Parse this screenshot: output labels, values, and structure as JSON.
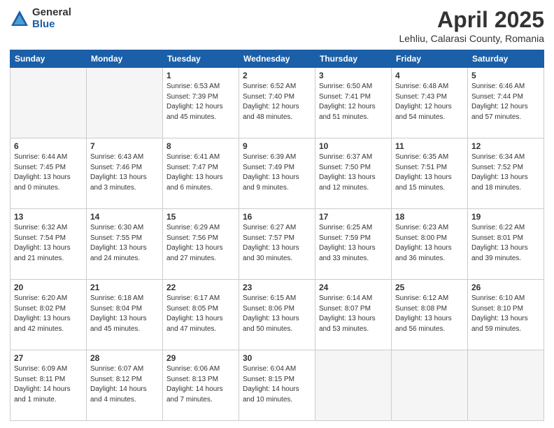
{
  "header": {
    "logo_general": "General",
    "logo_blue": "Blue",
    "main_title": "April 2025",
    "subtitle": "Lehliu, Calarasi County, Romania"
  },
  "calendar": {
    "days_of_week": [
      "Sunday",
      "Monday",
      "Tuesday",
      "Wednesday",
      "Thursday",
      "Friday",
      "Saturday"
    ],
    "weeks": [
      [
        {
          "day": "",
          "info": ""
        },
        {
          "day": "",
          "info": ""
        },
        {
          "day": "1",
          "info": "Sunrise: 6:53 AM\nSunset: 7:39 PM\nDaylight: 12 hours\nand 45 minutes."
        },
        {
          "day": "2",
          "info": "Sunrise: 6:52 AM\nSunset: 7:40 PM\nDaylight: 12 hours\nand 48 minutes."
        },
        {
          "day": "3",
          "info": "Sunrise: 6:50 AM\nSunset: 7:41 PM\nDaylight: 12 hours\nand 51 minutes."
        },
        {
          "day": "4",
          "info": "Sunrise: 6:48 AM\nSunset: 7:43 PM\nDaylight: 12 hours\nand 54 minutes."
        },
        {
          "day": "5",
          "info": "Sunrise: 6:46 AM\nSunset: 7:44 PM\nDaylight: 12 hours\nand 57 minutes."
        }
      ],
      [
        {
          "day": "6",
          "info": "Sunrise: 6:44 AM\nSunset: 7:45 PM\nDaylight: 13 hours\nand 0 minutes."
        },
        {
          "day": "7",
          "info": "Sunrise: 6:43 AM\nSunset: 7:46 PM\nDaylight: 13 hours\nand 3 minutes."
        },
        {
          "day": "8",
          "info": "Sunrise: 6:41 AM\nSunset: 7:47 PM\nDaylight: 13 hours\nand 6 minutes."
        },
        {
          "day": "9",
          "info": "Sunrise: 6:39 AM\nSunset: 7:49 PM\nDaylight: 13 hours\nand 9 minutes."
        },
        {
          "day": "10",
          "info": "Sunrise: 6:37 AM\nSunset: 7:50 PM\nDaylight: 13 hours\nand 12 minutes."
        },
        {
          "day": "11",
          "info": "Sunrise: 6:35 AM\nSunset: 7:51 PM\nDaylight: 13 hours\nand 15 minutes."
        },
        {
          "day": "12",
          "info": "Sunrise: 6:34 AM\nSunset: 7:52 PM\nDaylight: 13 hours\nand 18 minutes."
        }
      ],
      [
        {
          "day": "13",
          "info": "Sunrise: 6:32 AM\nSunset: 7:54 PM\nDaylight: 13 hours\nand 21 minutes."
        },
        {
          "day": "14",
          "info": "Sunrise: 6:30 AM\nSunset: 7:55 PM\nDaylight: 13 hours\nand 24 minutes."
        },
        {
          "day": "15",
          "info": "Sunrise: 6:29 AM\nSunset: 7:56 PM\nDaylight: 13 hours\nand 27 minutes."
        },
        {
          "day": "16",
          "info": "Sunrise: 6:27 AM\nSunset: 7:57 PM\nDaylight: 13 hours\nand 30 minutes."
        },
        {
          "day": "17",
          "info": "Sunrise: 6:25 AM\nSunset: 7:59 PM\nDaylight: 13 hours\nand 33 minutes."
        },
        {
          "day": "18",
          "info": "Sunrise: 6:23 AM\nSunset: 8:00 PM\nDaylight: 13 hours\nand 36 minutes."
        },
        {
          "day": "19",
          "info": "Sunrise: 6:22 AM\nSunset: 8:01 PM\nDaylight: 13 hours\nand 39 minutes."
        }
      ],
      [
        {
          "day": "20",
          "info": "Sunrise: 6:20 AM\nSunset: 8:02 PM\nDaylight: 13 hours\nand 42 minutes."
        },
        {
          "day": "21",
          "info": "Sunrise: 6:18 AM\nSunset: 8:04 PM\nDaylight: 13 hours\nand 45 minutes."
        },
        {
          "day": "22",
          "info": "Sunrise: 6:17 AM\nSunset: 8:05 PM\nDaylight: 13 hours\nand 47 minutes."
        },
        {
          "day": "23",
          "info": "Sunrise: 6:15 AM\nSunset: 8:06 PM\nDaylight: 13 hours\nand 50 minutes."
        },
        {
          "day": "24",
          "info": "Sunrise: 6:14 AM\nSunset: 8:07 PM\nDaylight: 13 hours\nand 53 minutes."
        },
        {
          "day": "25",
          "info": "Sunrise: 6:12 AM\nSunset: 8:08 PM\nDaylight: 13 hours\nand 56 minutes."
        },
        {
          "day": "26",
          "info": "Sunrise: 6:10 AM\nSunset: 8:10 PM\nDaylight: 13 hours\nand 59 minutes."
        }
      ],
      [
        {
          "day": "27",
          "info": "Sunrise: 6:09 AM\nSunset: 8:11 PM\nDaylight: 14 hours\nand 1 minute."
        },
        {
          "day": "28",
          "info": "Sunrise: 6:07 AM\nSunset: 8:12 PM\nDaylight: 14 hours\nand 4 minutes."
        },
        {
          "day": "29",
          "info": "Sunrise: 6:06 AM\nSunset: 8:13 PM\nDaylight: 14 hours\nand 7 minutes."
        },
        {
          "day": "30",
          "info": "Sunrise: 6:04 AM\nSunset: 8:15 PM\nDaylight: 14 hours\nand 10 minutes."
        },
        {
          "day": "",
          "info": ""
        },
        {
          "day": "",
          "info": ""
        },
        {
          "day": "",
          "info": ""
        }
      ]
    ]
  }
}
